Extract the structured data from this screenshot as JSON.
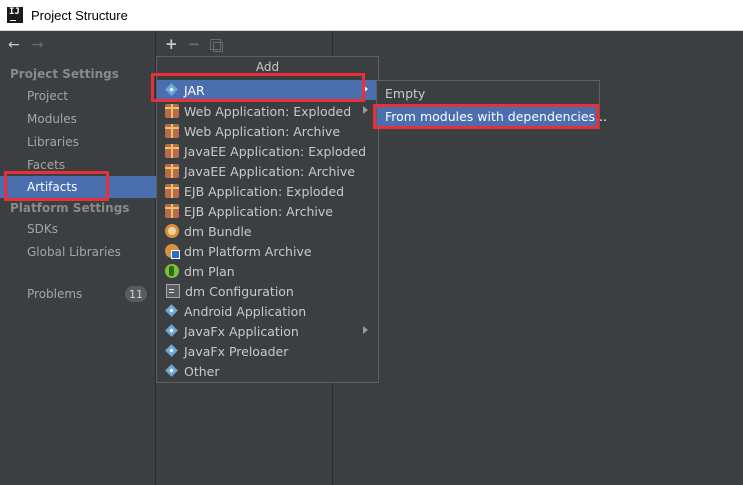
{
  "window": {
    "title": "Project Structure"
  },
  "sidebar": {
    "sections": [
      {
        "title": "Project Settings",
        "items": [
          "Project",
          "Modules",
          "Libraries",
          "Facets",
          "Artifacts"
        ]
      },
      {
        "title": "Platform Settings",
        "items": [
          "SDKs",
          "Global Libraries"
        ]
      }
    ],
    "problems": {
      "label": "Problems",
      "count": "11"
    },
    "selected": "Artifacts"
  },
  "popup": {
    "header": "Add",
    "items": [
      {
        "label": "JAR",
        "icon": "jar-diamond-icon",
        "submenu": true,
        "selected": true
      },
      {
        "label": "Web Application: Exploded",
        "icon": "web-app-icon",
        "submenu": true
      },
      {
        "label": "Web Application: Archive",
        "icon": "web-app-icon"
      },
      {
        "label": "JavaEE Application: Exploded",
        "icon": "javaee-icon"
      },
      {
        "label": "JavaEE Application: Archive",
        "icon": "javaee-icon"
      },
      {
        "label": "EJB Application: Exploded",
        "icon": "ejb-icon"
      },
      {
        "label": "EJB Application: Archive",
        "icon": "ejb-icon"
      },
      {
        "label": "dm Bundle",
        "icon": "dm-bundle-icon"
      },
      {
        "label": "dm Platform Archive",
        "icon": "dm-platform-icon"
      },
      {
        "label": "dm Plan",
        "icon": "dm-plan-icon"
      },
      {
        "label": "dm Configuration",
        "icon": "dm-configuration-icon"
      },
      {
        "label": "Android Application",
        "icon": "android-diamond-icon"
      },
      {
        "label": "JavaFx Application",
        "icon": "javafx-diamond-icon",
        "submenu": true
      },
      {
        "label": "JavaFx Preloader",
        "icon": "javafx-diamond-icon"
      },
      {
        "label": "Other",
        "icon": "other-diamond-icon"
      }
    ]
  },
  "submenu": {
    "items": [
      {
        "label": "Empty"
      },
      {
        "label": "From modules with dependencies...",
        "selected": true
      }
    ]
  },
  "colors": {
    "selection": "#4b6eaf",
    "highlight": "#e8303a",
    "background": "#3c3f41"
  }
}
